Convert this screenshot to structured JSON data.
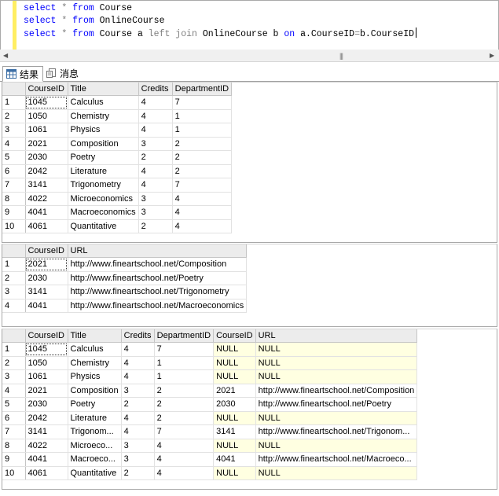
{
  "editor": {
    "lines": [
      {
        "kw1": "select",
        "star": "*",
        "kw2": "from",
        "tbl": "Course"
      },
      {
        "kw1": "select",
        "star": "*",
        "kw2": "from",
        "tbl": "OnlineCourse"
      },
      {
        "kw1": "select",
        "star": "*",
        "kw2": "from",
        "a": "Course a",
        "lj1": "left",
        "lj2": "join",
        "b": "OnlineCourse b",
        "on": "on",
        "cond_left": "a.CourseID",
        "eq": "=",
        "cond_right": "b.CourseID"
      }
    ]
  },
  "tabs": {
    "results": "结果",
    "messages": "消息"
  },
  "grid1": {
    "columns": [
      "CourseID",
      "Title",
      "Credits",
      "DepartmentID"
    ],
    "rows": [
      [
        "1",
        "1045",
        "Calculus",
        "4",
        "7"
      ],
      [
        "2",
        "1050",
        "Chemistry",
        "4",
        "1"
      ],
      [
        "3",
        "1061",
        "Physics",
        "4",
        "1"
      ],
      [
        "4",
        "2021",
        "Composition",
        "3",
        "2"
      ],
      [
        "5",
        "2030",
        "Poetry",
        "2",
        "2"
      ],
      [
        "6",
        "2042",
        "Literature",
        "4",
        "2"
      ],
      [
        "7",
        "3141",
        "Trigonometry",
        "4",
        "7"
      ],
      [
        "8",
        "4022",
        "Microeconomics",
        "3",
        "4"
      ],
      [
        "9",
        "4041",
        "Macroeconomics",
        "3",
        "4"
      ],
      [
        "10",
        "4061",
        "Quantitative",
        "2",
        "4"
      ]
    ]
  },
  "grid2": {
    "columns": [
      "CourseID",
      "URL"
    ],
    "rows": [
      [
        "1",
        "2021",
        "http://www.fineartschool.net/Composition"
      ],
      [
        "2",
        "2030",
        "http://www.fineartschool.net/Poetry"
      ],
      [
        "3",
        "3141",
        "http://www.fineartschool.net/Trigonometry"
      ],
      [
        "4",
        "4041",
        "http://www.fineartschool.net/Macroeconomics"
      ]
    ]
  },
  "grid3": {
    "columns": [
      "CourseID",
      "Title",
      "Credits",
      "DepartmentID",
      "CourseID",
      "URL"
    ],
    "rows": [
      [
        "1",
        "1045",
        "Calculus",
        "4",
        "7",
        "NULL",
        "NULL"
      ],
      [
        "2",
        "1050",
        "Chemistry",
        "4",
        "1",
        "NULL",
        "NULL"
      ],
      [
        "3",
        "1061",
        "Physics",
        "4",
        "1",
        "NULL",
        "NULL"
      ],
      [
        "4",
        "2021",
        "Composition",
        "3",
        "2",
        "2021",
        "http://www.fineartschool.net/Composition"
      ],
      [
        "5",
        "2030",
        "Poetry",
        "2",
        "2",
        "2030",
        "http://www.fineartschool.net/Poetry"
      ],
      [
        "6",
        "2042",
        "Literature",
        "4",
        "2",
        "NULL",
        "NULL"
      ],
      [
        "7",
        "3141",
        "Trigonom...",
        "4",
        "7",
        "3141",
        "http://www.fineartschool.net/Trigonom..."
      ],
      [
        "8",
        "4022",
        "Microeco...",
        "3",
        "4",
        "NULL",
        "NULL"
      ],
      [
        "9",
        "4041",
        "Macroeco...",
        "3",
        "4",
        "4041",
        "http://www.fineartschool.net/Macroeco..."
      ],
      [
        "10",
        "4061",
        "Quantitative",
        "2",
        "4",
        "NULL",
        "NULL"
      ]
    ]
  }
}
